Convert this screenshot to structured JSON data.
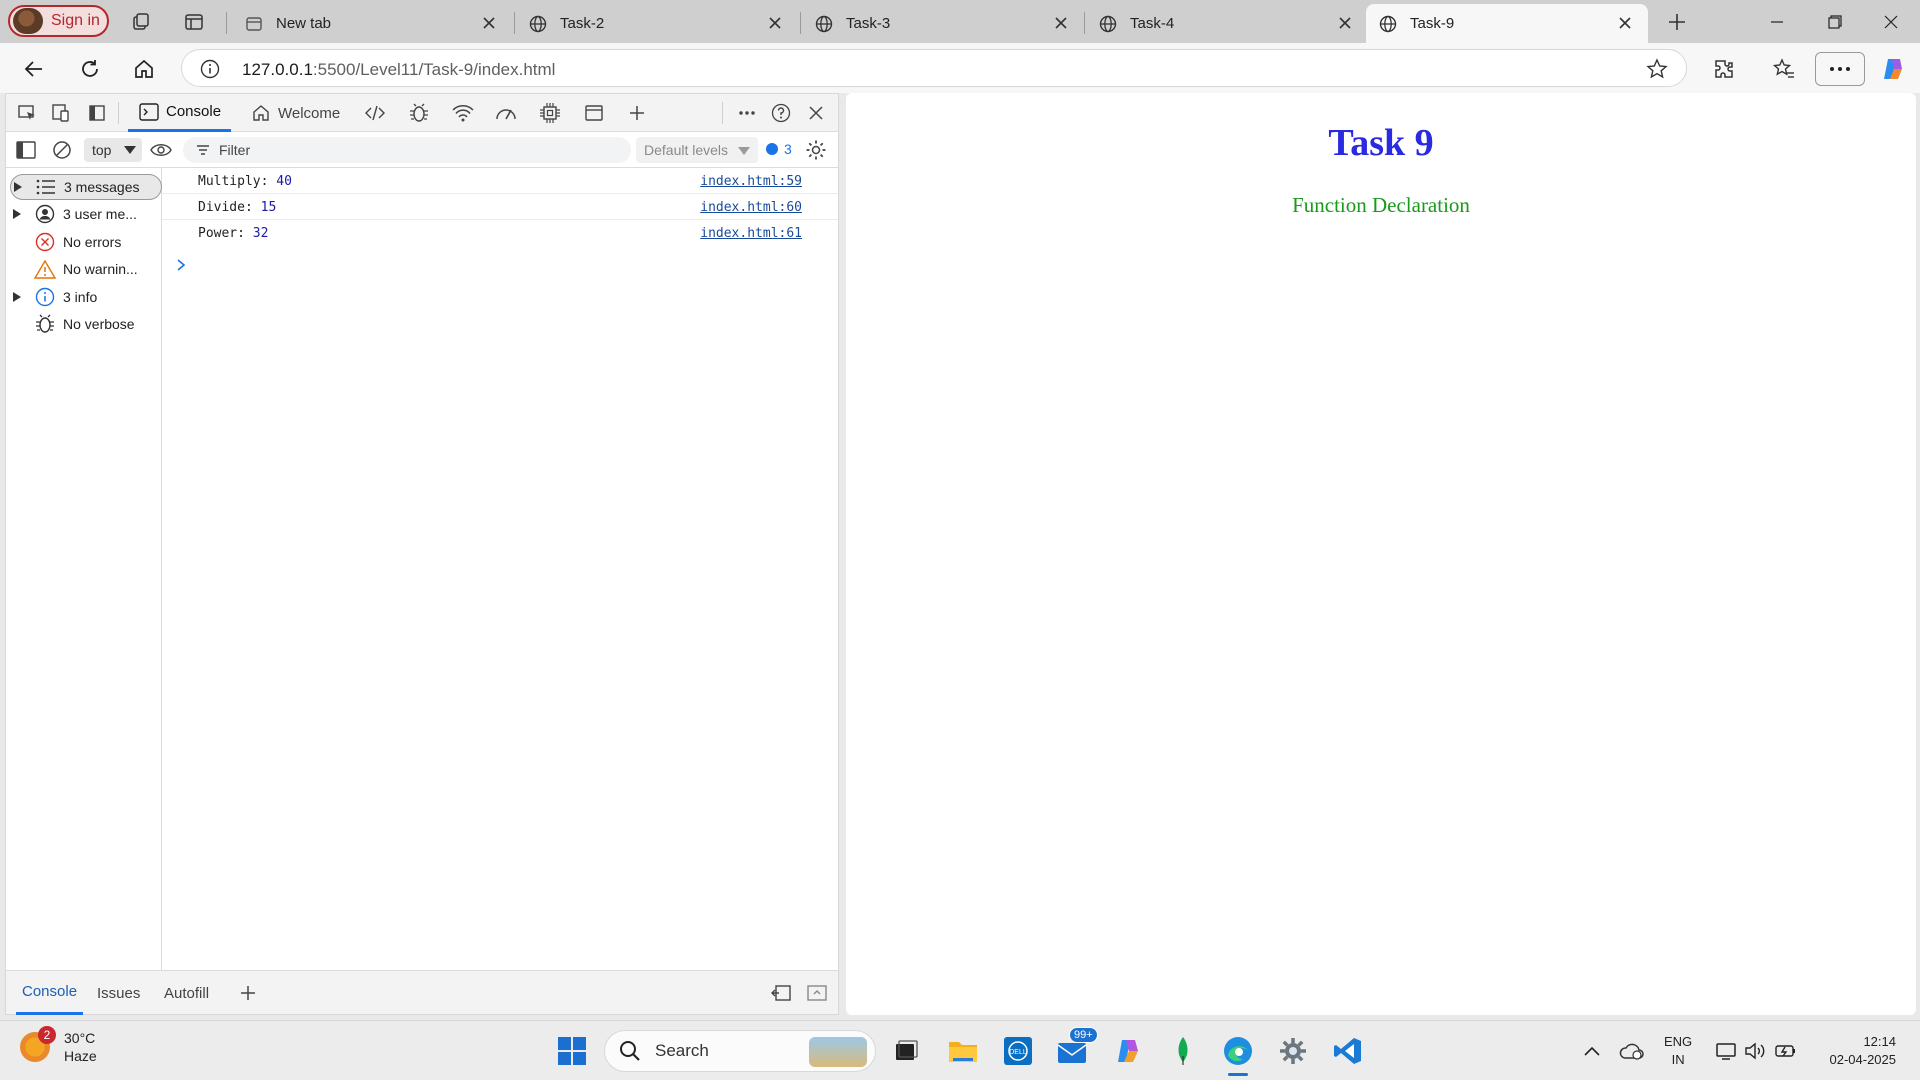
{
  "browser": {
    "sign_in_label": "Sign in",
    "tabs": [
      {
        "title": "New tab"
      },
      {
        "title": "Task-2"
      },
      {
        "title": "Task-3"
      },
      {
        "title": "Task-4"
      },
      {
        "title": "Task-9",
        "active": true
      }
    ],
    "address": {
      "host": "127.0.0.1",
      "path": ":5500/Level11/Task-9/index.html"
    }
  },
  "devtools": {
    "tabs": [
      {
        "label": "Console",
        "active": true
      },
      {
        "label": "Welcome"
      }
    ],
    "context": "top",
    "filter_placeholder": "Filter",
    "levels_label": "Default levels",
    "message_count": "3",
    "sidebar": [
      {
        "label": "3 messages",
        "icon": "list-icon",
        "expandable": true,
        "selected": true
      },
      {
        "label": "3 user me...",
        "icon": "user-icon",
        "expandable": true
      },
      {
        "label": "No errors",
        "icon": "error-icon",
        "expandable": false
      },
      {
        "label": "No warnin...",
        "icon": "warning-icon",
        "expandable": false
      },
      {
        "label": "3 info",
        "icon": "info-icon",
        "expandable": true
      },
      {
        "label": "No verbose",
        "icon": "bug-icon",
        "expandable": false
      }
    ],
    "logs": [
      {
        "label": "Multiply:",
        "value": "40",
        "source": "index.html:59"
      },
      {
        "label": "Divide:",
        "value": "15",
        "source": "index.html:60"
      },
      {
        "label": "Power:",
        "value": "32",
        "source": "index.html:61"
      }
    ],
    "drawer_tabs": [
      {
        "label": "Console",
        "active": true
      },
      {
        "label": "Issues"
      },
      {
        "label": "Autofill"
      }
    ]
  },
  "page": {
    "heading": "Task 9",
    "subheading": "Function Declaration",
    "heading_color": "#2a2ae0",
    "subheading_color": "#1a9a1a"
  },
  "taskbar": {
    "weather_badge": "2",
    "temperature": "30°C",
    "condition": "Haze",
    "search_placeholder": "Search",
    "mail_badge": "99+",
    "lang_top": "ENG",
    "lang_bottom": "IN",
    "time": "12:14",
    "date": "02-04-2025"
  }
}
